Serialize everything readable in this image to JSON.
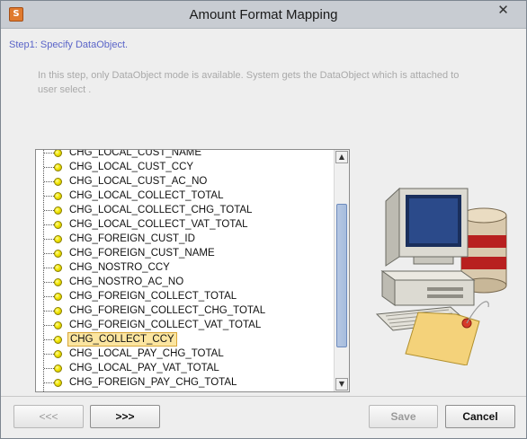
{
  "window": {
    "title": "Amount Format Mapping",
    "close_glyph": "✕",
    "app_icon_glyph": "S"
  },
  "step": {
    "title": "Step1: Specify DataObject.",
    "description": "In this step, only DataObject mode is available. System gets the DataObject which is attached to user select ."
  },
  "list": {
    "items": [
      {
        "label": "CHG_LOCAL_CUST_NAME",
        "selected": false
      },
      {
        "label": "CHG_LOCAL_CUST_CCY",
        "selected": false
      },
      {
        "label": "CHG_LOCAL_CUST_AC_NO",
        "selected": false
      },
      {
        "label": "CHG_LOCAL_COLLECT_TOTAL",
        "selected": false
      },
      {
        "label": "CHG_LOCAL_COLLECT_CHG_TOTAL",
        "selected": false
      },
      {
        "label": "CHG_LOCAL_COLLECT_VAT_TOTAL",
        "selected": false
      },
      {
        "label": "CHG_FOREIGN_CUST_ID",
        "selected": false
      },
      {
        "label": "CHG_FOREIGN_CUST_NAME",
        "selected": false
      },
      {
        "label": "CHG_NOSTRO_CCY",
        "selected": false
      },
      {
        "label": "CHG_NOSTRO_AC_NO",
        "selected": false
      },
      {
        "label": "CHG_FOREIGN_COLLECT_TOTAL",
        "selected": false
      },
      {
        "label": "CHG_FOREIGN_COLLECT_CHG_TOTAL",
        "selected": false
      },
      {
        "label": "CHG_FOREIGN_COLLECT_VAT_TOTAL",
        "selected": false
      },
      {
        "label": "CHG_COLLECT_CCY",
        "selected": true
      },
      {
        "label": "CHG_LOCAL_PAY_CHG_TOTAL",
        "selected": false
      },
      {
        "label": "CHG_LOCAL_PAY_VAT_TOTAL",
        "selected": false
      },
      {
        "label": "CHG_FOREIGN_PAY_CHG_TOTAL",
        "selected": false
      }
    ],
    "scroll_up_glyph": "▲",
    "scroll_down_glyph": "▼"
  },
  "buttons": {
    "prev_label": "<<<",
    "next_label": ">>>",
    "save_label": "Save",
    "cancel_label": "Cancel"
  },
  "colors": {
    "step_title": "#5a64c8",
    "description_text": "#a9a9a9",
    "selection_fill": "#fbe5a0"
  }
}
